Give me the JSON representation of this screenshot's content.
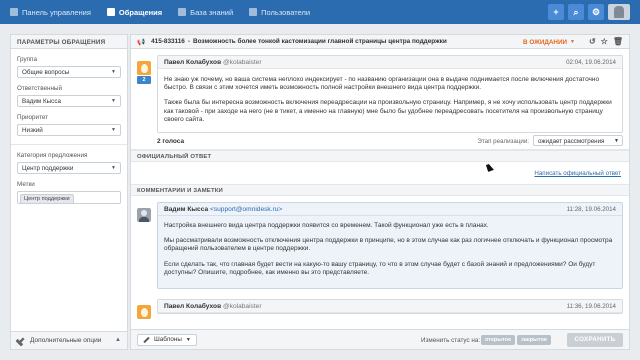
{
  "nav": {
    "items": [
      {
        "label": "Панель управления",
        "icon": "dashboard-icon"
      },
      {
        "label": "Обращения",
        "icon": "tickets-icon",
        "active": true
      },
      {
        "label": "База знаний",
        "icon": "book-icon"
      },
      {
        "label": "Пользователи",
        "icon": "users-icon"
      }
    ],
    "right_icons": [
      "plus",
      "search",
      "settings",
      "avatar"
    ]
  },
  "sidebar": {
    "title": "ПАРАМЕТРЫ ОБРАЩЕНИЯ",
    "group_label": "Группа",
    "group_value": "Общие вопросы",
    "assignee_label": "Ответственный",
    "assignee_value": "Вадим Кысса",
    "priority_label": "Приоритет",
    "priority_value": "Низкий",
    "category_label": "Категория предложения",
    "category_value": "Центр поддержки",
    "tags_label": "Метки",
    "tag": "Центр поддержки",
    "footer": "Дополнительные опции"
  },
  "ticket": {
    "id": "415-833116",
    "title": "Возможность более тонкой кастомизации главной страницы центра поддержки",
    "status": "В ОЖИДАНИИ"
  },
  "message1": {
    "author": "Павел Колабухов",
    "handle": "@kolabaister",
    "date": "02:04, 19.06.2014",
    "count": "2",
    "p1": "Не знаю уж почему, но ваша система неплохо индексирует - по названию организации она в выдаче поднимается после включения достаточно быстро. В связи с этим хочется иметь возможность полной настройки внешнего вида центра поддержки.",
    "p2": "Также была бы интересна возможность включения переадресации на произвольную страницу. Например, я не хочу использовать центр поддержки как таковой - при заходе на него (не в тикет, а именно на главную) мне было бы удобнее переадресовать посетителя на произвольную страницу своего сайта."
  },
  "votes": {
    "label": "2 голоса",
    "stage_label": "Этап реализации:",
    "stage_value": "ожидает рассмотрения"
  },
  "official": {
    "title": "ОФИЦИАЛЬНЫЙ ОТВЕТ",
    "link": "Написать официальный ответ"
  },
  "comments": {
    "title": "КОММЕНТАРИИ И ЗАМЕТКИ",
    "c1": {
      "author": "Вадим Кысса",
      "email": "<support@omnidesk.ru>",
      "date": "11:28, 19.06.2014",
      "p1": "Настройка внешнего вида центра поддержки появится со временем. Такой функционал уже есть в планах.",
      "p2": "Мы рассматривали возможность отключения центра поддержки в принципе, но в этом случае как раз логичнее отключать и функционал просмотра обращений пользователем в центре поддержки.",
      "p3": "Если сделать так, что главная будет вести на какую-то вашу страницу, то что в этом случае будет с базой знаний и предложениями? Ои будут доступны? Опишите, подробнее, как именно вы это представляете."
    },
    "c2": {
      "author": "Павел Колабухов",
      "handle": "@kolabaister",
      "date": "11:36, 19.06.2014"
    }
  },
  "bottom": {
    "templates": "Шаблоны",
    "change_status": "Изменить статус на:",
    "status_open": "открытое",
    "status_closed": "закрытое",
    "save": "СОХРАНИТЬ"
  }
}
